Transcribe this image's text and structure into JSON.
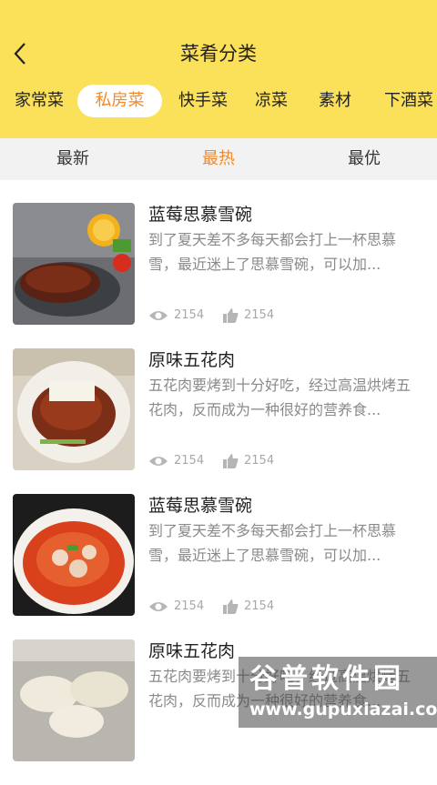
{
  "header": {
    "title": "菜肴分类"
  },
  "categories": [
    "家常菜",
    "私房菜",
    "快手菜",
    "凉菜",
    "素材",
    "下酒菜"
  ],
  "active_category": "私房菜",
  "sort_tabs": [
    "最新",
    "最热",
    "最优"
  ],
  "active_sort": "最热",
  "items": [
    {
      "name": "蓝莓思慕雪碗",
      "desc": "到了夏天差不多每天都会打上一杯思慕雪，最近迷上了思慕雪碗，可以加...",
      "views": "2154",
      "likes": "2154"
    },
    {
      "name": "原味五花肉",
      "desc": "五花肉要烤到十分好吃，经过高温烘烤五花肉，反而成为一种很好的营养食...",
      "views": "2154",
      "likes": "2154"
    },
    {
      "name": "蓝莓思慕雪碗",
      "desc": "到了夏天差不多每天都会打上一杯思慕雪，最近迷上了思慕雪碗，可以加...",
      "views": "2154",
      "likes": "2154"
    },
    {
      "name": "原味五花肉",
      "desc": "五花肉要烤到十分好吃，经过高温烘烤五花肉，反而成为一种很好的营养食...",
      "views": "",
      "likes": ""
    }
  ],
  "watermark": {
    "brand": "谷普软件园",
    "url": "www.gupuxiazai.com"
  },
  "colors": {
    "header_bg": "#fbe05a",
    "accent": "#f08a2b",
    "sort_bg": "#f2f2f2"
  }
}
